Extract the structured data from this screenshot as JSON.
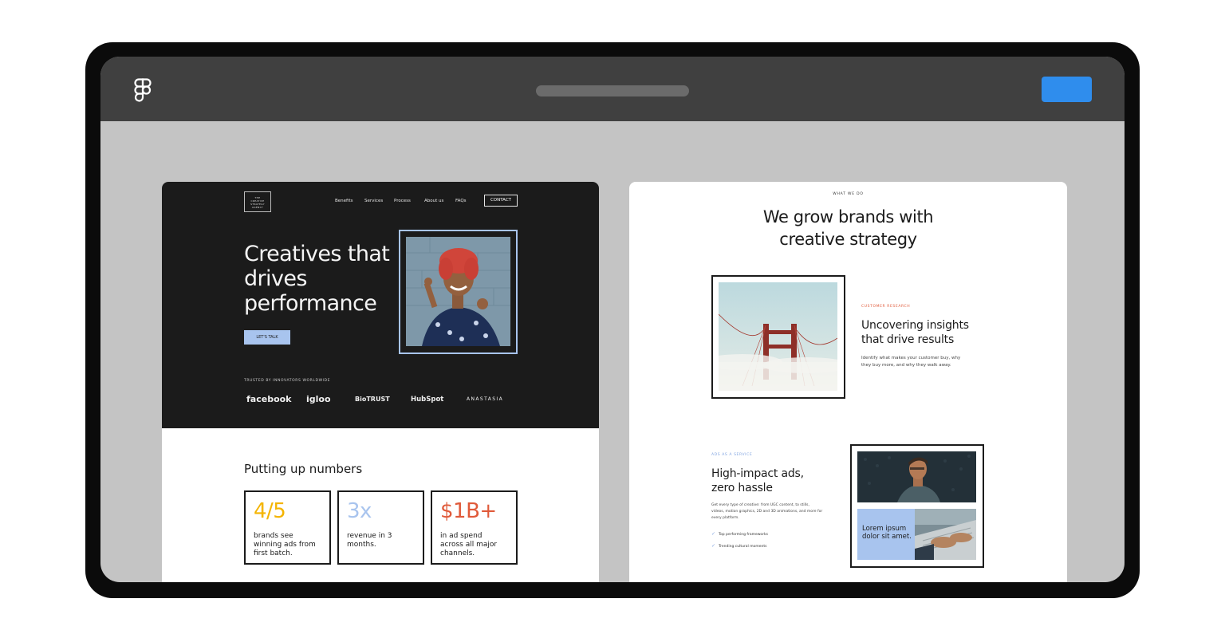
{
  "app": {
    "logo_icon": "figma-logo-icon",
    "accent_color": "#2f8ded"
  },
  "left_page": {
    "brand_text": [
      "THE",
      "CREATIVE",
      "STRATEGY",
      "AGENCY"
    ],
    "nav": [
      "Benefits",
      "Services",
      "Process",
      "About us",
      "FAQs"
    ],
    "nav_contact": "CONTACT",
    "hero_title": "Creatives that drives performance",
    "cta": "LET'S TALK",
    "trusted": "TRUSTED BY INNOVATORS WORLDWIDE",
    "logos": [
      "facebook",
      "igloo",
      "BioTRUST",
      "HubSpot",
      "ANASTASIA"
    ],
    "numbers_title": "Putting up numbers",
    "stats": [
      {
        "value": "4/5",
        "desc": "brands see winning ads from first batch.",
        "color": "#f4b400"
      },
      {
        "value": "3x",
        "desc": "revenue in 3 months.",
        "color": "#a8c4ee"
      },
      {
        "value": "$1B+",
        "desc": "in ad spend across all major channels.",
        "color": "#e05a3a"
      }
    ]
  },
  "right_page": {
    "eyebrow": "WHAT WE DO",
    "title_line1": "We grow brands with",
    "title_line2": "creative strategy",
    "research_eyebrow": "CUSTOMER RESEARCH",
    "research_title": "Uncovering insights that drive results",
    "research_body": "Identify what makes your customer buy, why they buy more, and why they walk away.",
    "ads_eyebrow": "ADS AS A SERVICE",
    "ads_title": "High-impact ads, zero hassle",
    "ads_body": "Get every type of creative: from UGC content, to stills, videos, motion graphics, 2D and 3D animations, and more for every platform.",
    "checks": [
      "Top performing frameworks",
      "Trending cultural moments"
    ],
    "lorem": "Lorem ipsum dolor sit amet."
  }
}
